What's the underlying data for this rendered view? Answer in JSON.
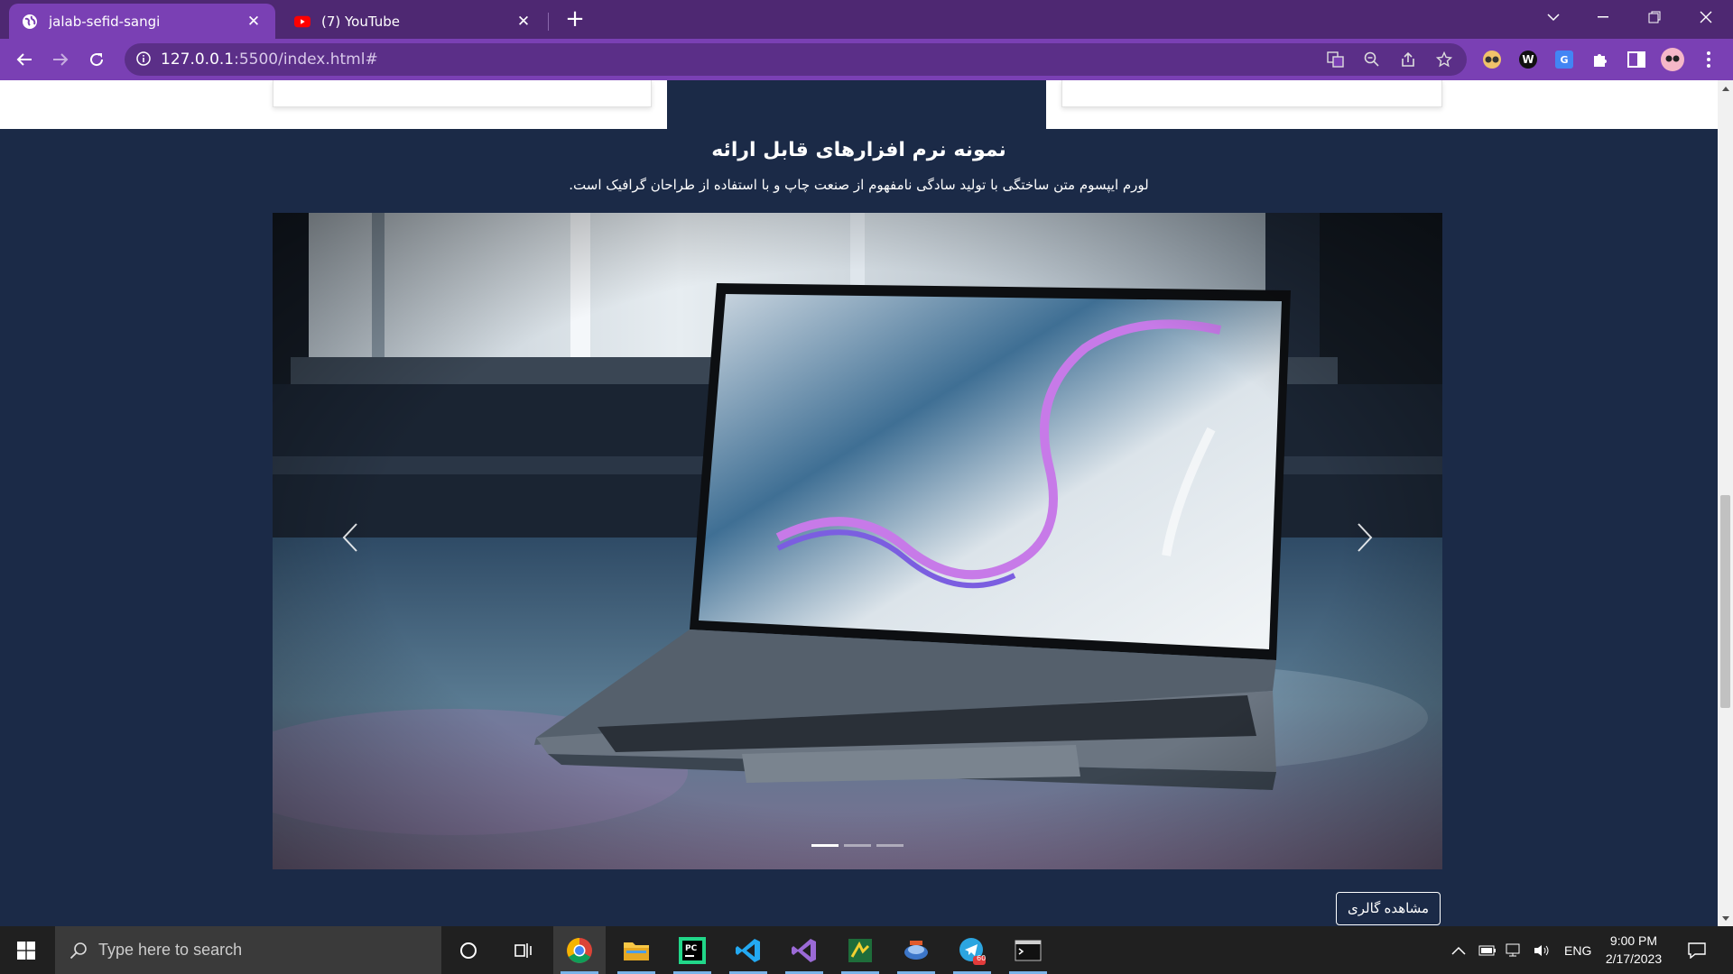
{
  "browser": {
    "tabs": [
      {
        "title": "jalab-sefid-sangi",
        "active": true,
        "icon": "globe-icon"
      },
      {
        "title": "(7) YouTube",
        "active": false,
        "icon": "youtube-icon"
      }
    ],
    "new_tab": "+",
    "url": {
      "host": "127.0.0.1",
      "rest": ":5500/index.html#"
    },
    "colors": {
      "frame": "#4e2872",
      "toolbar": "#7a40b4",
      "omnibox": "#5b2f88"
    }
  },
  "page": {
    "section_title": "نمونه نرم افزارهای قابل ارائه",
    "section_description": "لورم ایپسوم متن ساختگی با تولید سادگی نامفهوم از صنعت چاپ و با استفاده از طراحان گرافیک است.",
    "carousel": {
      "slide_count": 3,
      "active_index": 0,
      "image": "laptop-on-window-sill"
    },
    "gallery_button": "مشاهده گالری",
    "colors": {
      "background": "#1b2a47",
      "text": "#ffffff"
    }
  },
  "taskbar": {
    "search_placeholder": "Type here to search",
    "apps": [
      "cortana-icon",
      "task-view-icon",
      "chrome-icon",
      "file-explorer-icon",
      "pycharm-icon",
      "vscode-icon",
      "visual-studio-icon",
      "app-icon",
      "network-app-icon",
      "telegram-icon",
      "terminal-icon"
    ],
    "telegram_badge": "60",
    "language": "ENG",
    "time": "9:00 PM",
    "date": "2/17/2023"
  }
}
